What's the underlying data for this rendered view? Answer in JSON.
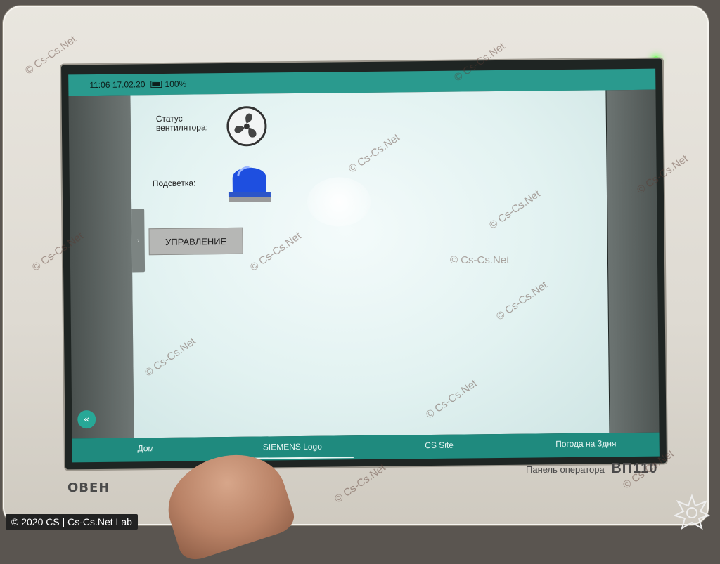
{
  "status_bar": {
    "text": "11:06 17.02.20",
    "battery": "100%"
  },
  "fan": {
    "label_line1": "Статус",
    "label_line2": "вентилятора:"
  },
  "light": {
    "label": "Подсветка:"
  },
  "control_button": {
    "label": "УПРАВЛЕНИЕ"
  },
  "nav": {
    "items": [
      "Дом",
      "SIEMENS Logo",
      "CS Site",
      "Погода на 3дня"
    ],
    "active_index": 1
  },
  "back_button": {
    "icon": "double-chevron-left-icon",
    "glyph": "«"
  },
  "branding": {
    "logo": "ОВЕН",
    "model_prefix": "Панель оператора",
    "model_name": "ВП110"
  },
  "watermark": {
    "text": "© Cs-Cs.Net"
  },
  "credit": {
    "text": "© 2020 CS | Cs-Cs.Net Lab"
  },
  "colors": {
    "status_bar": "#2a9a8e",
    "nav_bar": "#1f8a7e",
    "led": "#7dff6a",
    "beacon": "#1e4fe0"
  }
}
